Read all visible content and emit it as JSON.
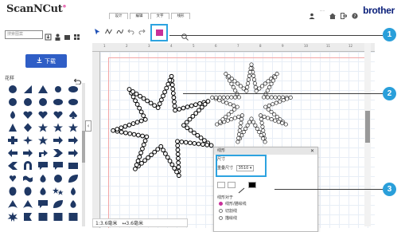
{
  "app": {
    "logo_text": "ScanNCut",
    "logo_mark": "®",
    "brand": "brother",
    "user_label": "·····"
  },
  "sidebar": {
    "search_placeholder": "搜索图案",
    "download_label": "下载",
    "shapes_label": "花样",
    "shapes": [
      "circle",
      "triangle-rt",
      "triangle",
      "circle-sm",
      "ellipse",
      "circle",
      "circle",
      "circle",
      "ellipse",
      "ellipse",
      "teardrop",
      "heart",
      "heart",
      "heart",
      "spade",
      "triangle-up",
      "diamond",
      "star",
      "star",
      "star",
      "cross",
      "star4",
      "star",
      "arrow-r",
      "arrow-r",
      "arrow-l",
      "arrow-r",
      "arrow-bent",
      "chevron",
      "arrow-r",
      "chevron-l",
      "horseshoe",
      "bubble",
      "bubble",
      "rect",
      "heart-sm",
      "wave",
      "drop",
      "circle",
      "leaf",
      "egg",
      "egg",
      "drop",
      "stars",
      "teardrop",
      "tri-shape",
      "tri-shape",
      "bubble",
      "leaf",
      "drop",
      "star-burst",
      "flag",
      "square",
      "square",
      "square"
    ]
  },
  "toolbar": {
    "tabs": [
      "设计",
      "编辑",
      "文字",
      "线形"
    ],
    "tools": [
      "pointer",
      "path",
      "pen",
      "undo",
      "redo",
      "trash",
      "search"
    ]
  },
  "status": {
    "width_label": "宽",
    "width_value": "1:3.6毫米",
    "height_value": "↔3.6毫米"
  },
  "panel": {
    "title": "线形",
    "close": "✕",
    "section_label": "尺寸",
    "size_label": "重叠尺寸",
    "size_value": "3510",
    "line_type_label": "线形对于",
    "radio_options": [
      "线形/描绘线",
      "切割线",
      "描绘线"
    ],
    "colors": {
      "accent": "#2da3e0",
      "magenta": "#c8309a",
      "brand": "#0a1f7a",
      "button": "#2f5ec6"
    }
  },
  "callouts": [
    "1",
    "2",
    "3"
  ],
  "ruler": [
    "1",
    "2",
    "3",
    "4",
    "5",
    "6",
    "7",
    "8",
    "9",
    "10",
    "11",
    "12"
  ]
}
